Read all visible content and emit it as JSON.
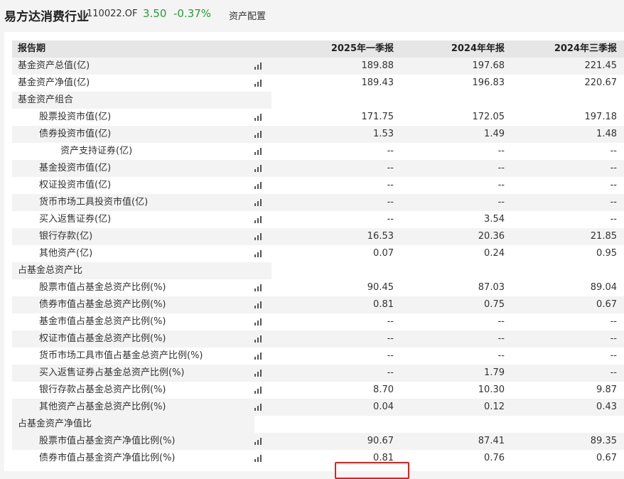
{
  "header": {
    "fund_name": "易方达消费行业",
    "fund_code": "110022.OF",
    "price": "3.50",
    "change": "-0.37%",
    "tab": "资产配置"
  },
  "colors": {
    "up_down_green": "#2a9a3a",
    "highlight_red": "#e02020",
    "header_gray": "#e6e6e6"
  },
  "table": {
    "columns": [
      "报告期",
      "2025年一季报",
      "2024年年报",
      "2024年三季报"
    ],
    "rows": [
      {
        "label": "基金资产总值(亿)",
        "level": 0,
        "icon": true,
        "values": [
          "189.88",
          "197.68",
          "221.45"
        ]
      },
      {
        "label": "基金资产净值(亿)",
        "level": 0,
        "icon": true,
        "values": [
          "189.43",
          "196.83",
          "220.67"
        ]
      },
      {
        "label": "基金资产组合",
        "level": 0,
        "section": true
      },
      {
        "label": "股票投资市值(亿)",
        "level": 1,
        "icon": true,
        "values": [
          "171.75",
          "172.05",
          "197.18"
        ]
      },
      {
        "label": "债券投资市值(亿)",
        "level": 1,
        "icon": true,
        "values": [
          "1.53",
          "1.49",
          "1.48"
        ]
      },
      {
        "label": "资产支持证券(亿)",
        "level": 2,
        "icon": true,
        "values": [
          "--",
          "--",
          "--"
        ]
      },
      {
        "label": "基金投资市值(亿)",
        "level": 1,
        "icon": true,
        "values": [
          "--",
          "--",
          "--"
        ]
      },
      {
        "label": "权证投资市值(亿)",
        "level": 1,
        "icon": true,
        "values": [
          "--",
          "--",
          "--"
        ]
      },
      {
        "label": "货币市场工具投资市值(亿)",
        "level": 1,
        "icon": true,
        "values": [
          "--",
          "--",
          "--"
        ]
      },
      {
        "label": "买入返售证券(亿)",
        "level": 1,
        "icon": true,
        "values": [
          "--",
          "3.54",
          "--"
        ]
      },
      {
        "label": "银行存款(亿)",
        "level": 1,
        "icon": true,
        "values": [
          "16.53",
          "20.36",
          "21.85"
        ]
      },
      {
        "label": "其他资产(亿)",
        "level": 1,
        "icon": true,
        "values": [
          "0.07",
          "0.24",
          "0.95"
        ]
      },
      {
        "label": "占基金总资产比",
        "level": 0,
        "section": true
      },
      {
        "label": "股票市值占基金总资产比例(%)",
        "level": 1,
        "icon": true,
        "values": [
          "90.45",
          "87.03",
          "89.04"
        ]
      },
      {
        "label": "债券市值占基金总资产比例(%)",
        "level": 1,
        "icon": true,
        "values": [
          "0.81",
          "0.75",
          "0.67"
        ]
      },
      {
        "label": "基金市值占基金总资产比例(%)",
        "level": 1,
        "icon": true,
        "values": [
          "--",
          "--",
          "--"
        ]
      },
      {
        "label": "权证市值占基金总资产比例(%)",
        "level": 1,
        "icon": true,
        "values": [
          "--",
          "--",
          "--"
        ]
      },
      {
        "label": "货币市场工具市值占基金总资产比例(%)",
        "level": 1,
        "icon": true,
        "values": [
          "--",
          "--",
          "--"
        ]
      },
      {
        "label": "买入返售证券占基金总资产比例(%)",
        "level": 1,
        "icon": true,
        "values": [
          "--",
          "1.79",
          "--"
        ]
      },
      {
        "label": "银行存款占基金总资产比例(%)",
        "level": 1,
        "icon": true,
        "values": [
          "8.70",
          "10.30",
          "9.87"
        ]
      },
      {
        "label": "其他资产占基金总资产比例(%)",
        "level": 1,
        "icon": true,
        "values": [
          "0.04",
          "0.12",
          "0.43"
        ]
      },
      {
        "label": "占基金资产净值比",
        "level": 0,
        "section": true
      },
      {
        "label": "股票市值占基金资产净值比例(%)",
        "level": 1,
        "icon": true,
        "values": [
          "90.67",
          "87.41",
          "89.35"
        ],
        "highlight": true
      },
      {
        "label": "债券市值占基金资产净值比例(%)",
        "level": 1,
        "icon": true,
        "values": [
          "0.81",
          "0.76",
          "0.67"
        ]
      }
    ]
  }
}
